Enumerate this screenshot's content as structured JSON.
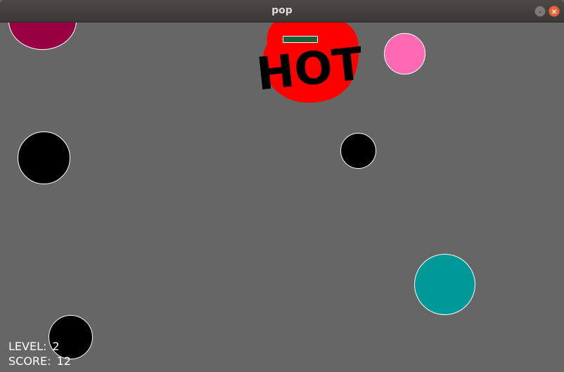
{
  "window": {
    "title": "pop",
    "minimize_glyph": "–",
    "close_glyph": "×"
  },
  "game": {
    "hot_bubble": {
      "label": "HOT",
      "color": "#ff0000"
    },
    "bubbles": [
      {
        "name": "bubble-magenta",
        "color": "#990044"
      },
      {
        "name": "bubble-pink",
        "color": "#ff69b4"
      },
      {
        "name": "bubble-black-left",
        "color": "#000000"
      },
      {
        "name": "bubble-black-center",
        "color": "#000000"
      },
      {
        "name": "bubble-teal",
        "color": "#009999"
      },
      {
        "name": "bubble-black-bottom",
        "color": "#000000"
      }
    ],
    "health_bar_color": "#1c6136",
    "background_color": "#666666"
  },
  "hud": {
    "level_label": "LEVEL:",
    "level_value": "2",
    "score_label": "SCORE:",
    "score_value": "12"
  }
}
